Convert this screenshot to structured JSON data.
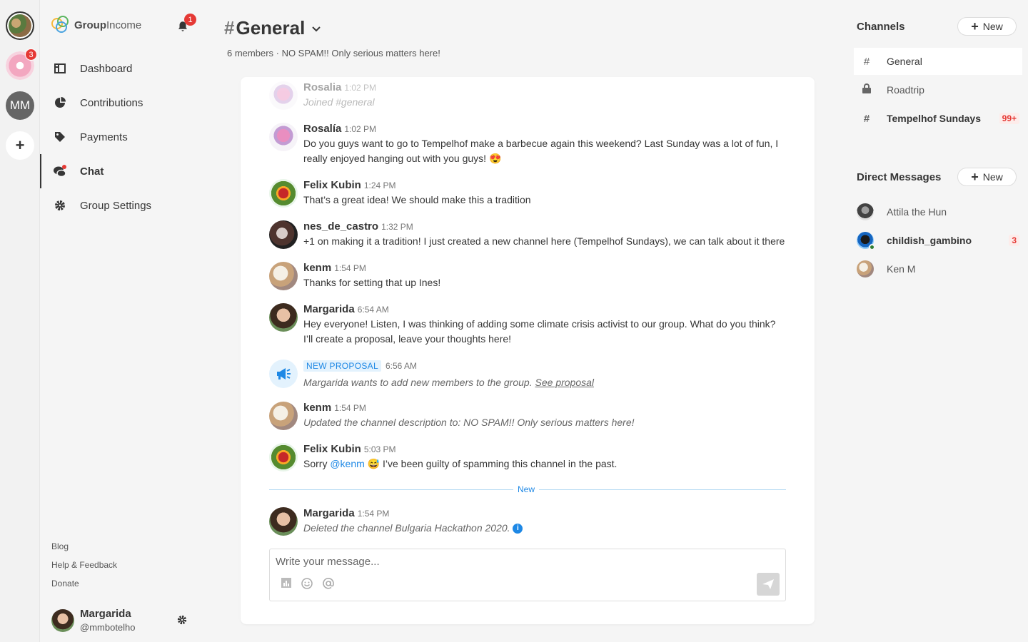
{
  "groups": {
    "badge": "3",
    "initials": "MM",
    "add": "+"
  },
  "nav": {
    "logo_a": "Group",
    "logo_b": "Income",
    "bell_badge": "1",
    "items": [
      {
        "label": "Dashboard",
        "icon": "dashboard-icon"
      },
      {
        "label": "Contributions",
        "icon": "pie-chart-icon"
      },
      {
        "label": "Payments",
        "icon": "tag-icon"
      },
      {
        "label": "Chat",
        "icon": "chat-icon"
      },
      {
        "label": "Group Settings",
        "icon": "gear-icon"
      }
    ],
    "footer": [
      "Blog",
      "Help & Feedback",
      "Donate"
    ],
    "user": {
      "name": "Margarida",
      "handle": "@mmbotelho"
    }
  },
  "header": {
    "hash": "#",
    "title": "General",
    "description": "6 members · NO SPAM!! Only serious matters here!"
  },
  "messages": [
    {
      "name": "Rosalia",
      "time": "1:02 PM",
      "text": "Joined #general"
    },
    {
      "name": "Rosalía",
      "time": "1:02 PM",
      "text": "Do you guys want to go to Tempelhof make a barbecue again this weekend? Last Sunday was a lot of fun, I really enjoyed hanging out with you guys! 😍"
    },
    {
      "name": "Felix Kubin",
      "time": "1:24 PM",
      "text": "That’s a great idea! We should make this a tradition"
    },
    {
      "name": "nes_de_castro",
      "time": "1:32 PM",
      "text": "+1 on making it a tradition! I just created a new channel here (Tempelhof Sundays), we can talk about it there"
    },
    {
      "name": "kenm",
      "time": "1:54 PM",
      "text": "Thanks for setting that up Ines!"
    },
    {
      "name": "Margarida",
      "time": "6:54 AM",
      "text": "Hey everyone! Listen, I was thinking of adding some climate crisis activist to our group. What do you think? I’ll create a proposal, leave your thoughts here!"
    },
    {
      "tag": "NEW PROPOSAL",
      "time": "6:56 AM",
      "text": "Margarida wants to add new members to the group.",
      "link": "See proposal"
    },
    {
      "name": "kenm",
      "time": "1:54 PM",
      "text": "Updated the channel description to: NO SPAM!! Only serious matters here!"
    },
    {
      "name": "Felix Kubin",
      "time": "5:03 PM",
      "text_a": "Sorry",
      "mention": "@kenm",
      "text_b": "😅 I’ve been guilty of spamming this channel in the past."
    },
    {
      "name": "Margarida",
      "time": "1:54 PM",
      "text": "Deleted the channel Bulgaria Hackathon 2020."
    }
  ],
  "new_separator": "New",
  "composer": {
    "placeholder": "Write your message..."
  },
  "channels": {
    "title": "Channels",
    "new_label": "New",
    "items": [
      {
        "name": "General",
        "icon": "hash-icon"
      },
      {
        "name": "Roadtrip",
        "icon": "lock-icon"
      },
      {
        "name": "Tempelhof Sundays",
        "icon": "hash-icon",
        "badge": "99+"
      }
    ]
  },
  "dms": {
    "title": "Direct Messages",
    "new_label": "New",
    "items": [
      {
        "name": "Attila the Hun"
      },
      {
        "name": "childish_gambino",
        "badge": "3"
      },
      {
        "name": "Ken M"
      }
    ]
  }
}
